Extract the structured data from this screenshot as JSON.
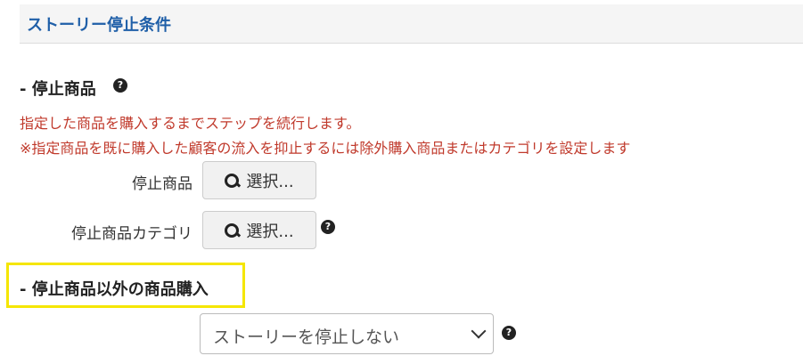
{
  "panel": {
    "title": "ストーリー停止条件"
  },
  "stop_product_section": {
    "heading": "- 停止商品",
    "help_glyph": "?",
    "note_line1": "指定した商品を購入するまでステップを続行します。",
    "note_line2": "※指定商品を既に購入した顧客の流入を抑止するには除外購入商品またはカテゴリを設定します",
    "product_row": {
      "label": "停止商品",
      "button_label": "選択..."
    },
    "category_row": {
      "label": "停止商品カテゴリ",
      "button_label": "選択...",
      "help_glyph": "?"
    }
  },
  "other_purchase_section": {
    "heading": "- 停止商品以外の商品購入",
    "select_value": "ストーリーを停止しない",
    "help_glyph": "?"
  },
  "colors": {
    "title_blue": "#1f5fa8",
    "note_red": "#c0392b",
    "highlight_yellow": "#f5e600"
  },
  "icons": [
    "question-circle-icon",
    "search-icon",
    "chevron-down-icon"
  ]
}
